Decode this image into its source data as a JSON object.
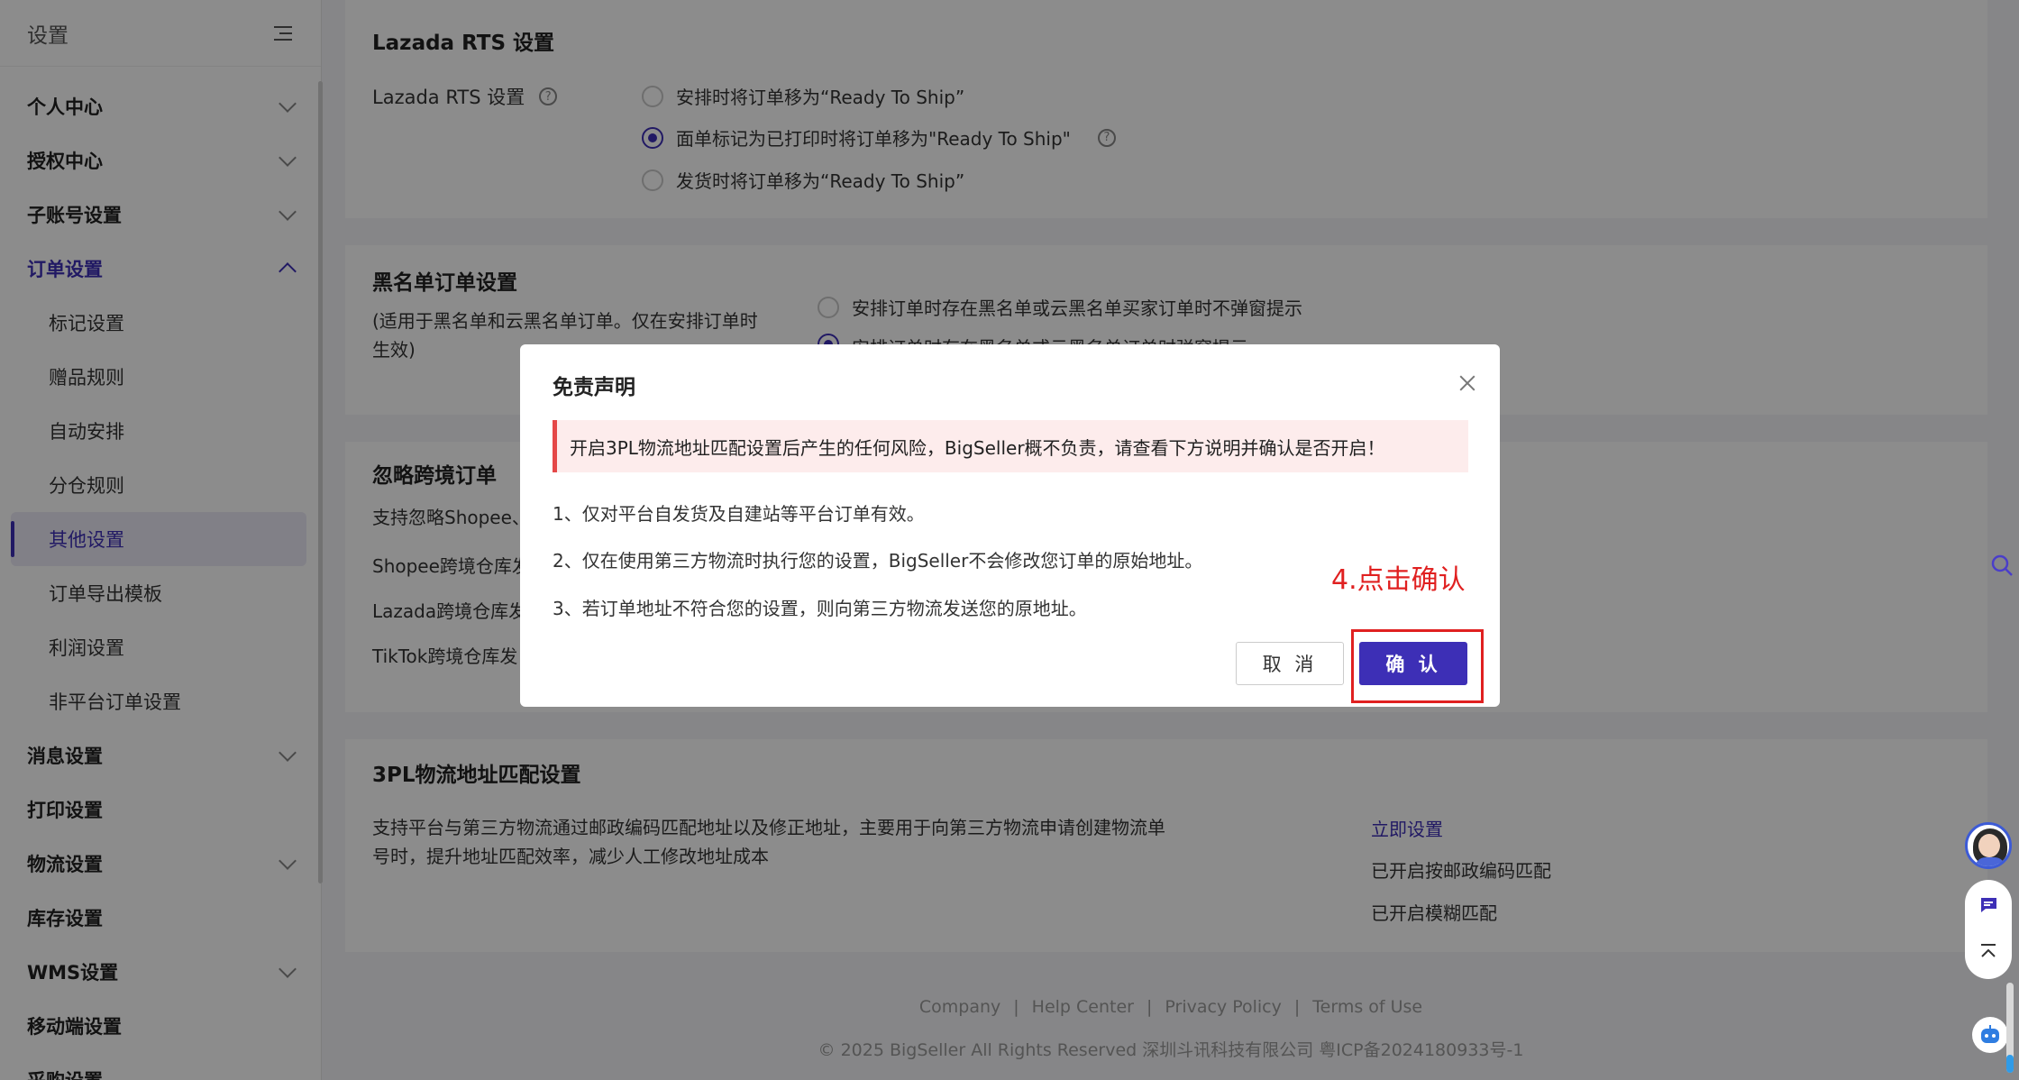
{
  "sidebar": {
    "title": "设置",
    "items": [
      {
        "label": "个人中心"
      },
      {
        "label": "授权中心"
      },
      {
        "label": "子账号设置"
      },
      {
        "label": "订单设置"
      }
    ],
    "sub_items": [
      {
        "label": "标记设置"
      },
      {
        "label": "赠品规则"
      },
      {
        "label": "自动安排"
      },
      {
        "label": "分仓规则"
      },
      {
        "label": "其他设置"
      },
      {
        "label": "订单导出模板"
      },
      {
        "label": "利润设置"
      },
      {
        "label": "非平台订单设置"
      }
    ],
    "items_after": [
      {
        "label": "消息设置"
      },
      {
        "label": "打印设置"
      },
      {
        "label": "物流设置"
      },
      {
        "label": "库存设置"
      },
      {
        "label": "WMS设置"
      },
      {
        "label": "移动端设置"
      },
      {
        "label": "采购设置"
      }
    ]
  },
  "rts": {
    "title": "Lazada RTS 设置",
    "label": "Lazada RTS 设置",
    "options": [
      "安排时将订单移为“Ready To Ship”",
      "面单标记为已打印时将订单移为\"Ready To Ship\"",
      "发货时将订单移为“Ready To Ship”"
    ],
    "selected_index": 1
  },
  "blacklist": {
    "title": "黑名单订单设置",
    "desc_line1": "(适用于黑名单和云黑名单订单。仅在安排订单时",
    "desc_line2": "生效)",
    "option1": "安排订单时存在黑名单或云黑名单买家订单时不弹窗提示",
    "option2": "安排订单时存在黑名单或云黑名单订单时弹窗提示"
  },
  "cross_border": {
    "title": "忽略跨境订单",
    "line1": "支持忽略Shopee、",
    "line2": "Shopee跨境仓库发",
    "line3": "Lazada跨境仓库发",
    "line4": "TikTok跨境仓库发"
  },
  "tpl": {
    "title": "3PL物流地址匹配设置",
    "desc_line1": "支持平台与第三方物流通过邮政编码匹配地址以及修正地址，主要用于向第三方物流申请创建物流单",
    "desc_line2": "号时，提升地址匹配效率，减少人工修改地址成本",
    "link": "立即设置",
    "status1": "已开启按邮政编码匹配",
    "status2": "已开启模糊匹配"
  },
  "footer": {
    "links": [
      "Company",
      "Help Center",
      "Privacy Policy",
      "Terms of Use"
    ],
    "copyright": "© 2025 BigSeller All Rights Reserved   深圳斗讯科技有限公司   粤ICP备2024180933号-1"
  },
  "dialog": {
    "title": "免责声明",
    "alert": "开启3PL物流地址匹配设置后产生的任何风险，BigSeller概不负责，请查看下方说明并确认是否开启！",
    "lines": [
      "1、仅对平台自发货及自建站等平台订单有效。",
      "2、仅在使用第三方物流时执行您的设置，BigSeller不会修改您订单的原始地址。",
      "3、若订单地址不符合您的设置，则向第三方物流发送您的原地址。"
    ],
    "annotation": "4.点击确认",
    "cancel_label": "取 消",
    "ok_label": "确 认"
  },
  "colors": {
    "accent": "#3d2fb6",
    "alert_border": "#e54848",
    "annotation": "#e02020"
  }
}
